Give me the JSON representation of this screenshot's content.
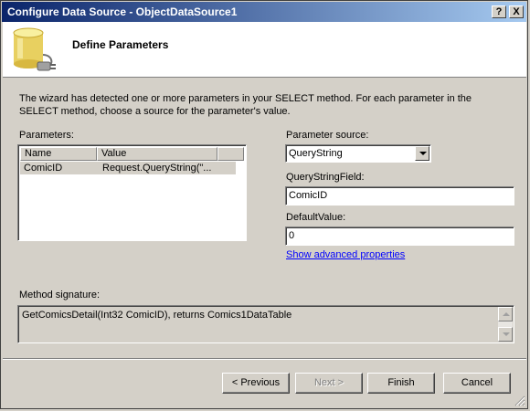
{
  "window": {
    "title": "Configure Data Source - ObjectDataSource1",
    "help_button": "?",
    "close_button": "X"
  },
  "header": {
    "title": "Define Parameters",
    "icon": "database-plug-icon"
  },
  "description": "The wizard has detected one or more parameters in your SELECT method. For each parameter in the SELECT method, choose a source for the parameter's value.",
  "parameters": {
    "label": "Parameters:",
    "columns": [
      "Name",
      "Value"
    ],
    "rows": [
      {
        "name": "ComicID",
        "value": "Request.QueryString(\"..."
      }
    ]
  },
  "parameter_source": {
    "label": "Parameter source:",
    "selected": "QueryString"
  },
  "querystring_field": {
    "label": "QueryStringField:",
    "value": "ComicID"
  },
  "default_value": {
    "label": "DefaultValue:",
    "value": "0"
  },
  "advanced_link": "Show advanced properties",
  "method_signature": {
    "label": "Method signature:",
    "value": "GetComicsDetail(Int32 ComicID), returns Comics1DataTable"
  },
  "buttons": {
    "previous": "< Previous",
    "next": "Next >",
    "finish": "Finish",
    "cancel": "Cancel"
  },
  "colors": {
    "titlebar_start": "#0a246a",
    "titlebar_end": "#a6caf0",
    "dialog_bg": "#d4d0c8",
    "link": "#0000ff"
  }
}
